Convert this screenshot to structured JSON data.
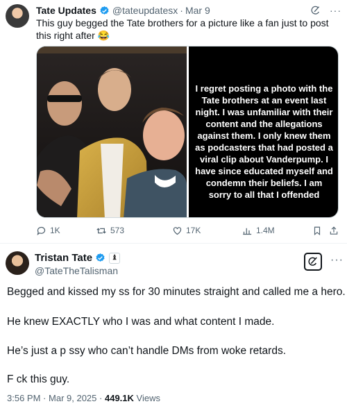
{
  "quoted": {
    "name": "Tate Updates",
    "handle": "@tateupdatesx",
    "separator": "·",
    "date": "Mar 9",
    "text": "This guy begged the Tate brothers for a picture like a fan just to post this right after 😂",
    "panel_text": "I regret posting a photo with the Tate brothers at an event last night.  I was unfamiliar with their content and the allegations against them. I only knew them as podcasters that had posted a viral clip about Vanderpump. I have since educated myself and condemn their beliefs. I am sorry to all that I offended",
    "stats": {
      "replies": "1K",
      "reposts": "573",
      "likes": "17K",
      "views": "1.4M"
    }
  },
  "tweet": {
    "name": "Tristan Tate",
    "badge_glyph": "♝",
    "handle": "@TateTheTalisman",
    "more": "···",
    "lines": [
      "Begged and kissed my   ss for 30 minutes straight and called me a hero.",
      "He knew EXACTLY who I was and what content I made.",
      "He’s just a p   ssy who can’t handle DMs from woke retards.",
      "F   ck this guy."
    ],
    "time": "3:56 PM",
    "separator": "·",
    "date": "Mar 9, 2025",
    "views_count": "449.1K",
    "views_label": "Views"
  },
  "colors": {
    "verified": "#1d9bf0",
    "muted": "#536471",
    "text": "#0f1419"
  },
  "icons": [
    "verified-badge-icon",
    "grok-icon",
    "more-icon",
    "reply-icon",
    "repost-icon",
    "like-icon",
    "views-icon",
    "bookmark-icon",
    "share-icon"
  ]
}
